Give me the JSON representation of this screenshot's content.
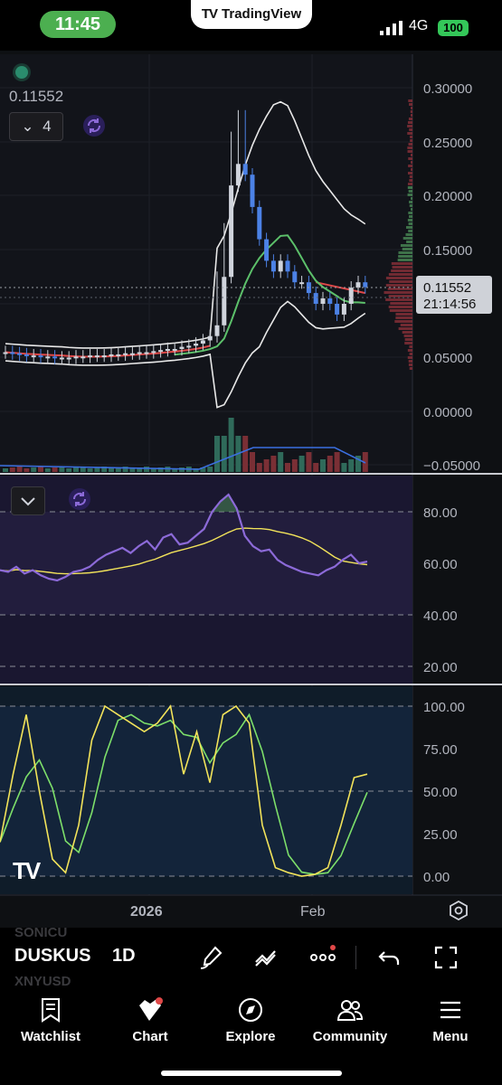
{
  "status_bar": {
    "time": "11:45",
    "app_name": "TradingView",
    "network": "4G",
    "battery": "100"
  },
  "chart": {
    "header_price": "0.11552",
    "indicator_count": "4",
    "current_price_label": "0.11552",
    "countdown": "21:14:56",
    "price_axis": [
      "0.30000",
      "0.25000",
      "0.20000",
      "0.15000",
      "0.05000",
      "0.00000",
      "−0.05000"
    ],
    "rsi_axis": [
      "80.00",
      "60.00",
      "40.00",
      "20.00"
    ],
    "stoch_axis": [
      "100.00",
      "75.00",
      "50.00",
      "25.00",
      "0.00"
    ],
    "time_axis": [
      "2026",
      "Feb"
    ],
    "colors": {
      "up": "#4c82e6",
      "down": "#e04848",
      "rsi": "#8c6ad8",
      "signal": "#f2e35a",
      "stoch_k": "#f2e35a",
      "stoch_d": "#7ddf6a"
    }
  },
  "chart_data": {
    "type": "line",
    "price_ylim": [
      -0.05,
      0.3
    ],
    "rsi_ylim": [
      20,
      80
    ],
    "stoch_ylim": [
      0,
      100
    ],
    "last_price": 0.11552
  },
  "toolbar": {
    "symbol": "DUSKUS",
    "symbol_prev": "SONICU",
    "symbol_next": "XNYUSD",
    "interval": "1D"
  },
  "nav": {
    "watchlist": "Watchlist",
    "chart": "Chart",
    "explore": "Explore",
    "community": "Community",
    "menu": "Menu"
  }
}
